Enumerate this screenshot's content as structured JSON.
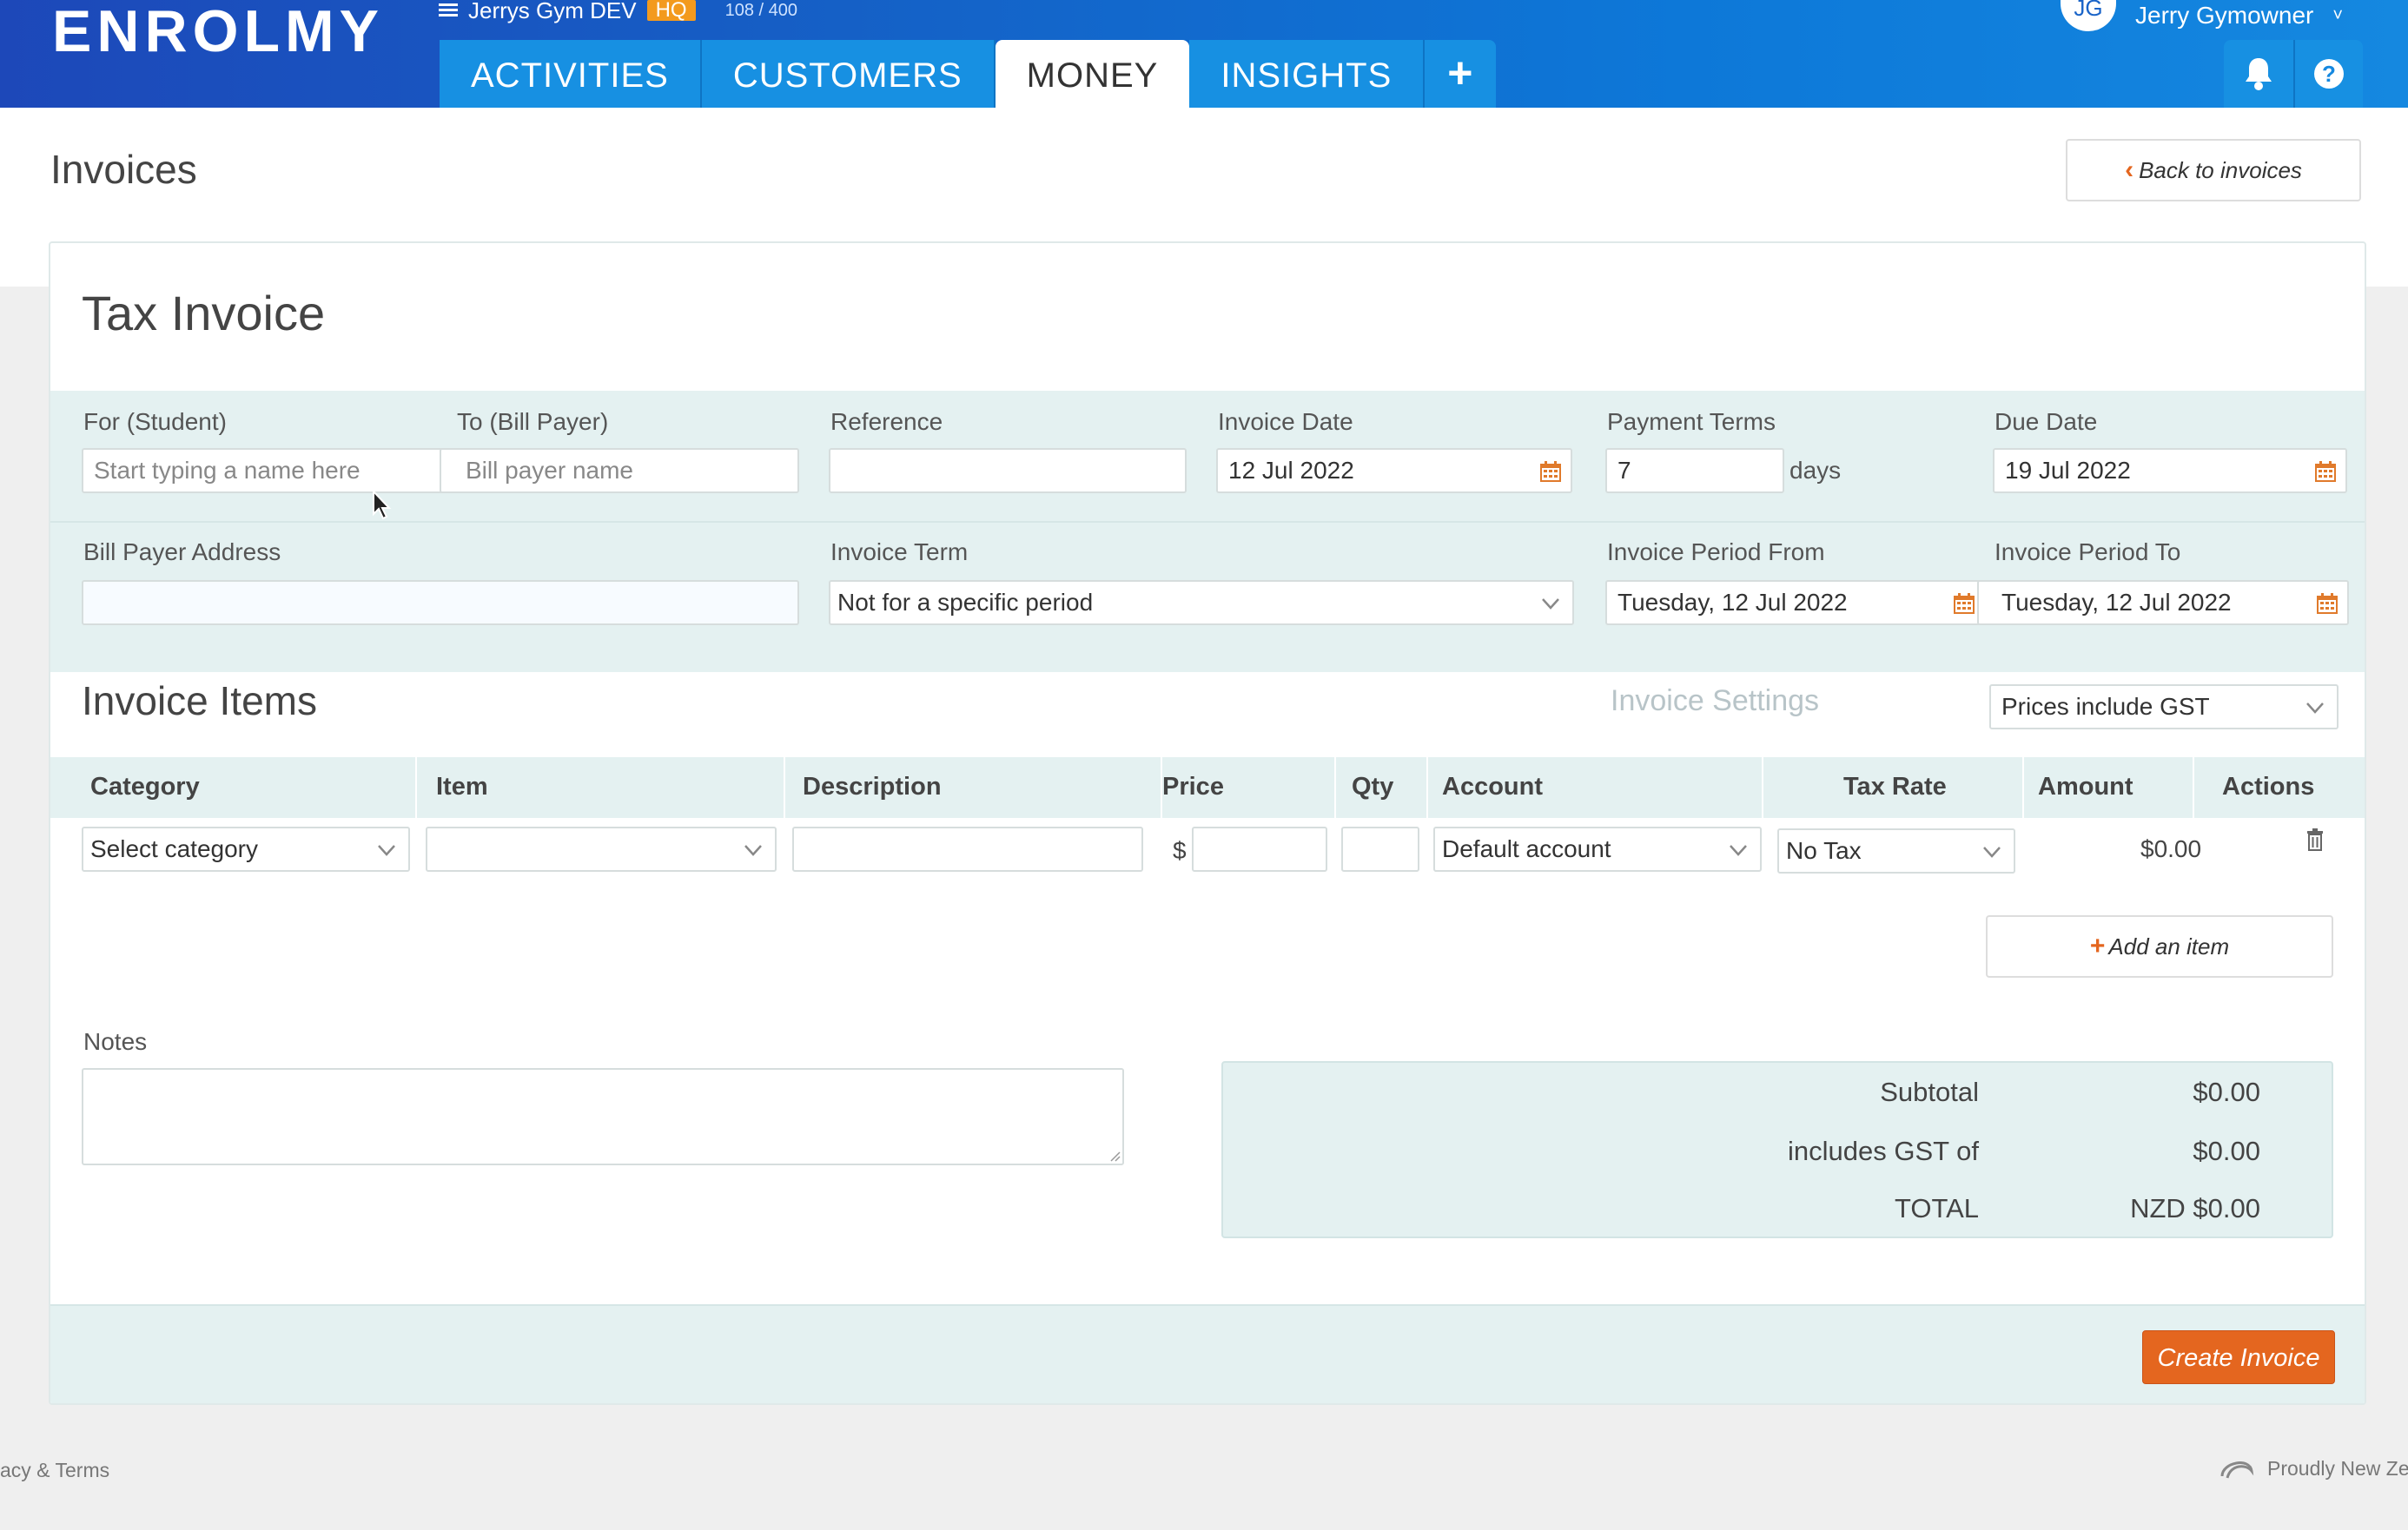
{
  "app": {
    "logo": "ENROLMY"
  },
  "gym": {
    "name": "Jerrys Gym DEV",
    "badge": "HQ",
    "count": "108 / 400"
  },
  "nav": {
    "tabs": [
      "ACTIVITIES",
      "CUSTOMERS",
      "MONEY",
      "INSIGHTS"
    ],
    "plus": "+"
  },
  "user": {
    "initials": "JG",
    "name": "Jerry Gymowner",
    "caret": "˅"
  },
  "page": {
    "title": "Invoices",
    "back_label": "Back to invoices"
  },
  "invoice": {
    "title": "Tax Invoice",
    "for_label": "For (Student)",
    "for_placeholder": "Start typing a name here",
    "to_label": "To (Bill Payer)",
    "to_placeholder": "Bill payer name",
    "reference_label": "Reference",
    "reference_value": "",
    "invoice_date_label": "Invoice Date",
    "invoice_date": "12 Jul 2022",
    "payment_terms_label": "Payment Terms",
    "payment_terms": "7",
    "days_label": "days",
    "due_date_label": "Due Date",
    "due_date": "19 Jul 2022",
    "bill_address_label": "Bill Payer Address",
    "invoice_term_label": "Invoice Term",
    "invoice_term": "Not for a specific period",
    "period_from_label": "Invoice Period From",
    "period_from": "Tuesday, 12 Jul 2022",
    "period_to_label": "Invoice Period To",
    "period_to": "Tuesday, 12 Jul 2022"
  },
  "items": {
    "title": "Invoice Items",
    "settings_label": "Invoice Settings",
    "gst_mode": "Prices include GST",
    "columns": [
      "Category",
      "Item",
      "Description",
      "Price",
      "Qty",
      "Account",
      "Tax Rate",
      "Amount",
      "Actions"
    ],
    "row": {
      "category": "Select category",
      "item": "",
      "description": "",
      "currency": "$",
      "price": "",
      "qty": "",
      "account": "Default account",
      "tax_rate": "No Tax",
      "amount": "$0.00"
    },
    "add_label": "Add an item"
  },
  "notes": {
    "label": "Notes"
  },
  "totals": {
    "subtotal_label": "Subtotal",
    "subtotal": "$0.00",
    "gst_label": "includes GST of",
    "gst": "$0.00",
    "total_label": "TOTAL",
    "total": "NZD $0.00"
  },
  "actions": {
    "create_label": "Create Invoice"
  },
  "footer": {
    "left": "acy & Terms",
    "right": "Proudly New Ze"
  },
  "colors": {
    "brand_blue": "#1560c6",
    "accent_orange": "#e4661f",
    "band": "#e4f1f1"
  }
}
